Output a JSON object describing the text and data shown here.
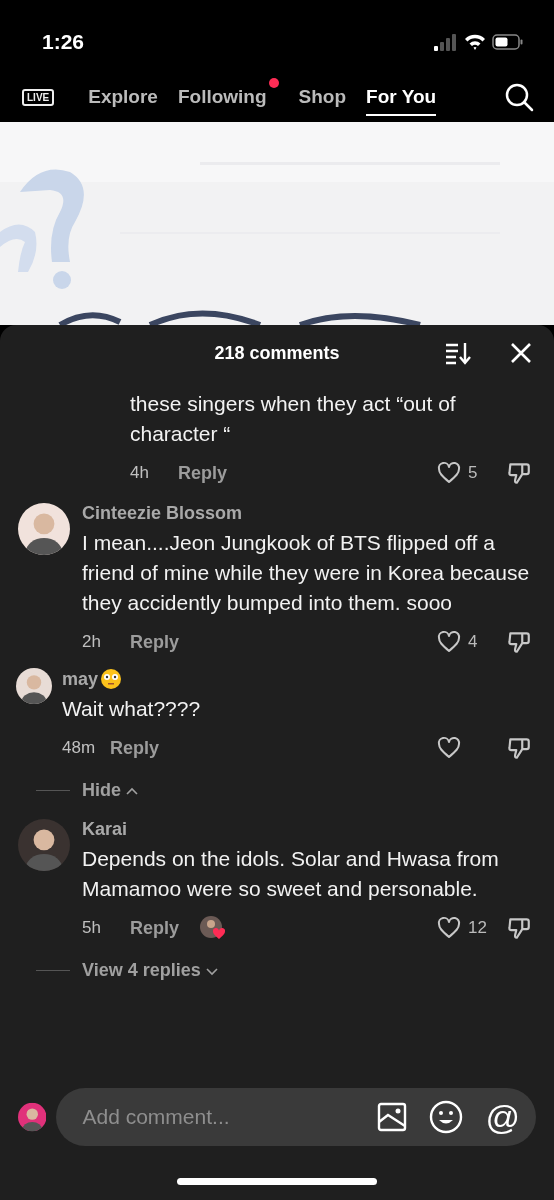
{
  "status_bar": {
    "time": "1:26"
  },
  "top_nav": {
    "live_label": "LIVE",
    "tabs": [
      {
        "label": "Explore",
        "selected": false,
        "badge": false
      },
      {
        "label": "Following",
        "selected": false,
        "badge": true
      },
      {
        "label": "Shop",
        "selected": false,
        "badge": false
      },
      {
        "label": "For You",
        "selected": true,
        "badge": false
      }
    ]
  },
  "comments_sheet": {
    "title": "218 comments",
    "comments": [
      {
        "kind": "reply_tail",
        "text": "these singers when they act “out of character “",
        "time": "4h",
        "reply": "Reply",
        "likes": "5",
        "liked": false
      },
      {
        "kind": "comment",
        "author": "Cinteezie Blossom",
        "text": "I mean....Jeon Jungkook of BTS flipped off a friend of mine while they were in Korea because they accidently bumped into them. sooo",
        "time": "2h",
        "reply": "Reply",
        "likes": "4",
        "liked": false,
        "children": [
          {
            "author": "may",
            "flushed_emoji": true,
            "text": "Wait what????",
            "time": "48m",
            "reply": "Reply",
            "liked": false
          }
        ],
        "toggle": {
          "label": "Hide",
          "expanded": true
        }
      },
      {
        "kind": "comment",
        "author": "Karai",
        "text": "Depends on the idols. Solar and Hwasa from Mamamoo were so sweet and personable.",
        "time": "5h",
        "reply": "Reply",
        "likes": "12",
        "liked": false,
        "creator_liked": true,
        "toggle": {
          "label": "View 4 replies",
          "expanded": false
        }
      }
    ]
  },
  "comment_input": {
    "placeholder": "Add comment...",
    "mention": "@"
  }
}
